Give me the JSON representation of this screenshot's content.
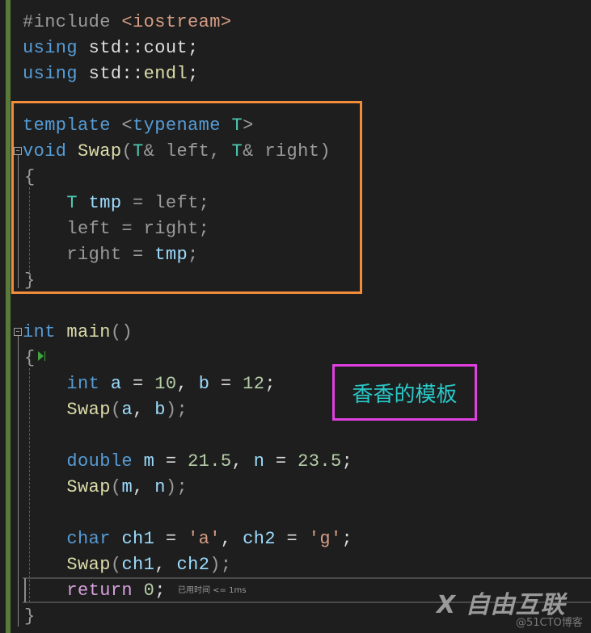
{
  "editor": {
    "lines": [
      {
        "tokens": [
          {
            "t": "#include ",
            "c": "pp"
          },
          {
            "t": "<iostream>",
            "c": "str"
          }
        ]
      },
      {
        "tokens": [
          {
            "t": "using",
            "c": "kw"
          },
          {
            "t": " std::cout;",
            "c": "plain"
          }
        ]
      },
      {
        "tokens": [
          {
            "t": "using",
            "c": "kw"
          },
          {
            "t": " std::",
            "c": "plain"
          },
          {
            "t": "endl",
            "c": "fn"
          },
          {
            "t": ";",
            "c": "plain"
          }
        ]
      },
      {
        "tokens": [
          {
            "t": "template",
            "c": "kw"
          },
          {
            "t": " <",
            "c": "gray"
          },
          {
            "t": "typename",
            "c": "kw"
          },
          {
            "t": " ",
            "c": "plain"
          },
          {
            "t": "T",
            "c": "ty"
          },
          {
            "t": ">",
            "c": "gray"
          }
        ]
      },
      {
        "tokens": [
          {
            "t": "void",
            "c": "kw"
          },
          {
            "t": " ",
            "c": "plain"
          },
          {
            "t": "Swap",
            "c": "fn"
          },
          {
            "t": "(",
            "c": "par"
          },
          {
            "t": "T",
            "c": "ty"
          },
          {
            "t": "& left, ",
            "c": "gray"
          },
          {
            "t": "T",
            "c": "ty"
          },
          {
            "t": "& right)",
            "c": "gray"
          }
        ]
      },
      {
        "tokens": [
          {
            "t": "{",
            "c": "gray"
          }
        ]
      },
      {
        "tokens": [
          {
            "t": "    ",
            "c": "plain"
          },
          {
            "t": "T",
            "c": "ty"
          },
          {
            "t": " ",
            "c": "plain"
          },
          {
            "t": "tmp",
            "c": "var"
          },
          {
            "t": " = left;",
            "c": "gray"
          }
        ]
      },
      {
        "tokens": [
          {
            "t": "    left = right;",
            "c": "gray"
          }
        ]
      },
      {
        "tokens": [
          {
            "t": "    right = ",
            "c": "gray"
          },
          {
            "t": "tmp",
            "c": "var"
          },
          {
            "t": ";",
            "c": "gray"
          }
        ]
      },
      {
        "tokens": [
          {
            "t": "}",
            "c": "gray"
          }
        ]
      },
      {
        "tokens": [
          {
            "t": "int",
            "c": "kw"
          },
          {
            "t": " ",
            "c": "plain"
          },
          {
            "t": "main",
            "c": "fn"
          },
          {
            "t": "()",
            "c": "par"
          }
        ]
      },
      {
        "tokens": [
          {
            "t": "{",
            "c": "gray"
          }
        ]
      },
      {
        "tokens": [
          {
            "t": "    ",
            "c": "plain"
          },
          {
            "t": "int",
            "c": "kw"
          },
          {
            "t": " ",
            "c": "plain"
          },
          {
            "t": "a",
            "c": "var"
          },
          {
            "t": " = ",
            "c": "plain"
          },
          {
            "t": "10",
            "c": "num"
          },
          {
            "t": ", ",
            "c": "plain"
          },
          {
            "t": "b",
            "c": "var"
          },
          {
            "t": " = ",
            "c": "plain"
          },
          {
            "t": "12",
            "c": "num"
          },
          {
            "t": ";",
            "c": "plain"
          }
        ]
      },
      {
        "tokens": [
          {
            "t": "    ",
            "c": "plain"
          },
          {
            "t": "Swap",
            "c": "fn"
          },
          {
            "t": "(",
            "c": "par"
          },
          {
            "t": "a",
            "c": "var"
          },
          {
            "t": ", ",
            "c": "plain"
          },
          {
            "t": "b",
            "c": "var"
          },
          {
            "t": ");",
            "c": "par"
          }
        ]
      },
      {
        "tokens": [
          {
            "t": "    ",
            "c": "plain"
          },
          {
            "t": "double",
            "c": "kw"
          },
          {
            "t": " ",
            "c": "plain"
          },
          {
            "t": "m",
            "c": "var"
          },
          {
            "t": " = ",
            "c": "plain"
          },
          {
            "t": "21.5",
            "c": "num"
          },
          {
            "t": ", ",
            "c": "plain"
          },
          {
            "t": "n",
            "c": "var"
          },
          {
            "t": " = ",
            "c": "plain"
          },
          {
            "t": "23.5",
            "c": "num"
          },
          {
            "t": ";",
            "c": "plain"
          }
        ]
      },
      {
        "tokens": [
          {
            "t": "    ",
            "c": "plain"
          },
          {
            "t": "Swap",
            "c": "fn"
          },
          {
            "t": "(",
            "c": "par"
          },
          {
            "t": "m",
            "c": "var"
          },
          {
            "t": ", ",
            "c": "plain"
          },
          {
            "t": "n",
            "c": "var"
          },
          {
            "t": ");",
            "c": "par"
          }
        ]
      },
      {
        "tokens": [
          {
            "t": "    ",
            "c": "plain"
          },
          {
            "t": "char",
            "c": "kw"
          },
          {
            "t": " ",
            "c": "plain"
          },
          {
            "t": "ch1",
            "c": "var"
          },
          {
            "t": " = ",
            "c": "plain"
          },
          {
            "t": "'a'",
            "c": "str"
          },
          {
            "t": ", ",
            "c": "plain"
          },
          {
            "t": "ch2",
            "c": "var"
          },
          {
            "t": " = ",
            "c": "plain"
          },
          {
            "t": "'g'",
            "c": "str"
          },
          {
            "t": ";",
            "c": "plain"
          }
        ]
      },
      {
        "tokens": [
          {
            "t": "    ",
            "c": "plain"
          },
          {
            "t": "Swap",
            "c": "fn"
          },
          {
            "t": "(",
            "c": "par"
          },
          {
            "t": "ch1",
            "c": "var"
          },
          {
            "t": ", ",
            "c": "plain"
          },
          {
            "t": "ch2",
            "c": "var"
          },
          {
            "t": ");",
            "c": "par"
          }
        ]
      },
      {
        "tokens": [
          {
            "t": "    ",
            "c": "plain"
          },
          {
            "t": "return",
            "c": "ctl"
          },
          {
            "t": " ",
            "c": "plain"
          },
          {
            "t": "0",
            "c": "num"
          },
          {
            "t": ";",
            "c": "plain"
          }
        ]
      },
      {
        "tokens": [
          {
            "t": "}",
            "c": "gray"
          }
        ]
      }
    ],
    "elapsed_hint": "已用时间 <= 1ms"
  },
  "annotation": {
    "note_text": "香香的模板",
    "orange_box_color": "#f08c3a",
    "magenta_box_color": "#e040e0",
    "note_color": "#2ac9c9"
  },
  "watermark": {
    "logo_text": "X 自由互联",
    "sub_text": "@51CTO博客"
  }
}
